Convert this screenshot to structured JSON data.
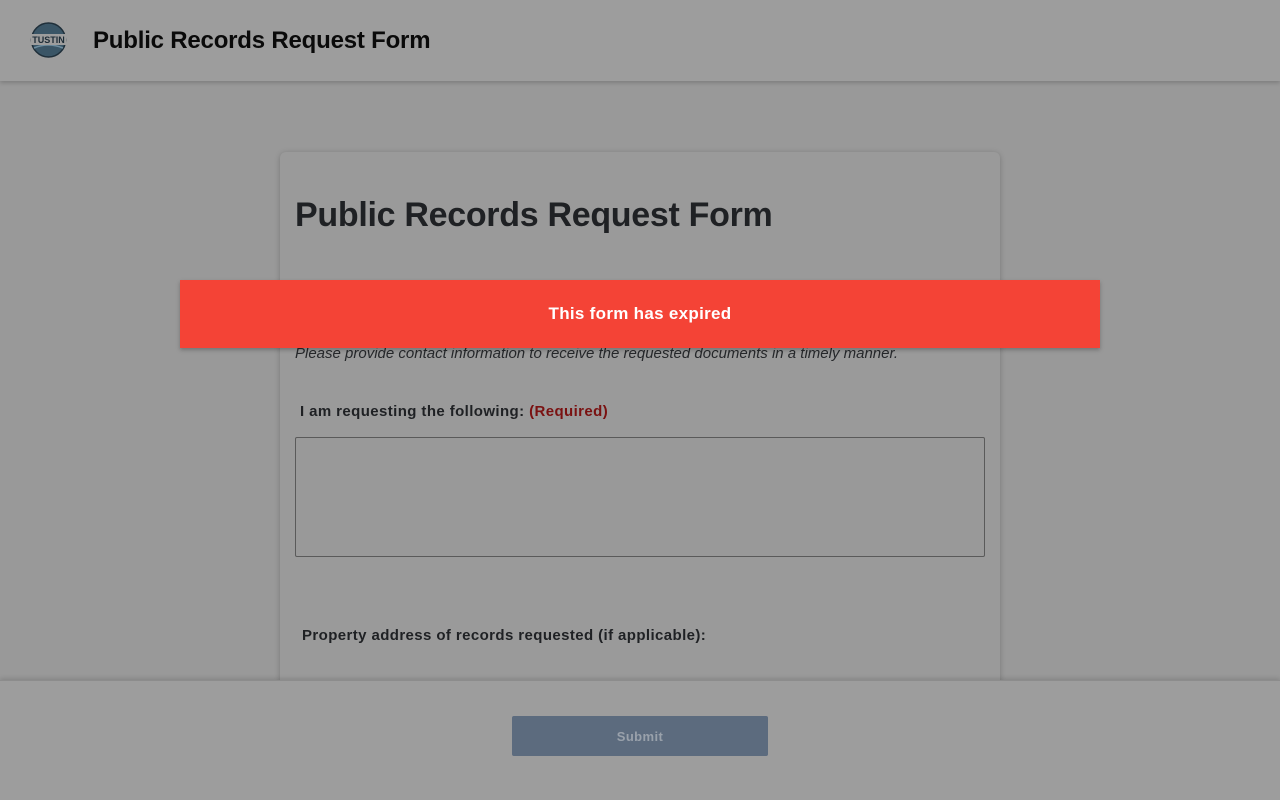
{
  "header": {
    "logo_text": "TUSTIN",
    "title": "Public Records Request Form"
  },
  "form": {
    "title": "Public Records Request Form",
    "instructions": "Please provide contact information to receive the requested documents in a timely manner.",
    "request_label": "I am requesting the following:",
    "required_marker": "(Required)",
    "request_value": "",
    "address_label": "Property address of records requested (if applicable):"
  },
  "banner": {
    "text": "This form has expired",
    "color": "#f44336"
  },
  "footer": {
    "submit_label": "Submit"
  },
  "icons": {
    "logo": "tustin-city-seal-icon"
  }
}
